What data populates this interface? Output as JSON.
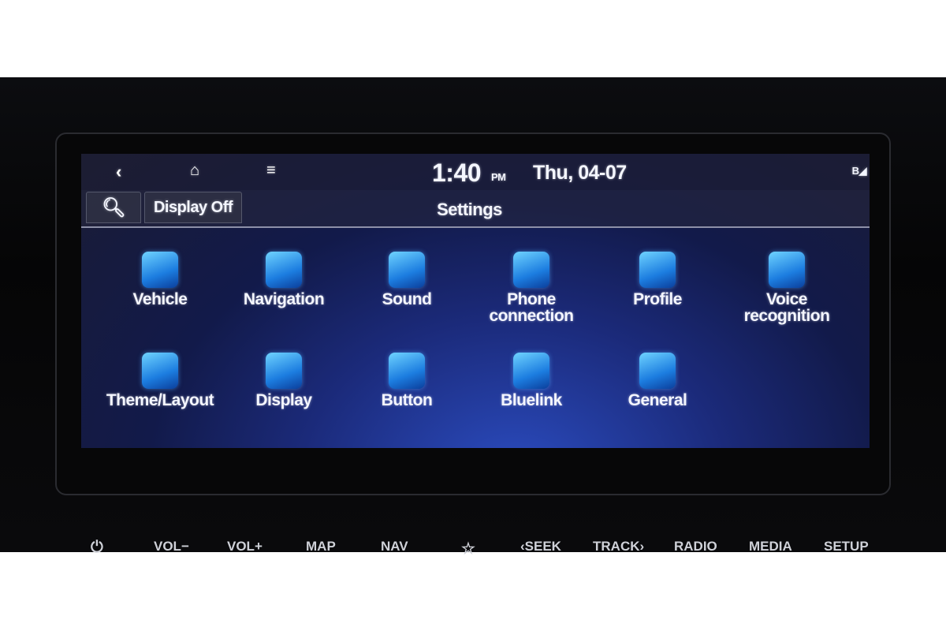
{
  "status": {
    "time": "1:40",
    "ampm": "PM",
    "date": "Thu, 04-07"
  },
  "toolbar": {
    "display_off": "Display Off",
    "title": "Settings"
  },
  "menu": [
    {
      "label": "Vehicle",
      "icon": "car-gear-icon"
    },
    {
      "label": "Navigation",
      "icon": "navigation-icon"
    },
    {
      "label": "Sound",
      "icon": "speaker-icon"
    },
    {
      "label": "Phone connection",
      "icon": "phone-bluetooth-icon"
    },
    {
      "label": "Profile",
      "icon": "profile-card-icon"
    },
    {
      "label": "Voice recognition",
      "icon": "microphone-icon"
    },
    {
      "label": "Theme/Layout",
      "icon": "theme-icon"
    },
    {
      "label": "Display",
      "icon": "display-icon"
    },
    {
      "label": "Button",
      "icon": "button-hand-icon"
    },
    {
      "label": "Bluelink",
      "icon": "bluelink-icon"
    },
    {
      "label": "General",
      "icon": "gear-icon"
    }
  ],
  "hardkeys": [
    "VOL−",
    "VOL+",
    "MAP",
    "NAV",
    "‹SEEK",
    "TRACK›",
    "RADIO",
    "MEDIA",
    "SETUP"
  ],
  "colors": {
    "accent": "#2a7fe6",
    "screen": "#1b2a7a"
  }
}
